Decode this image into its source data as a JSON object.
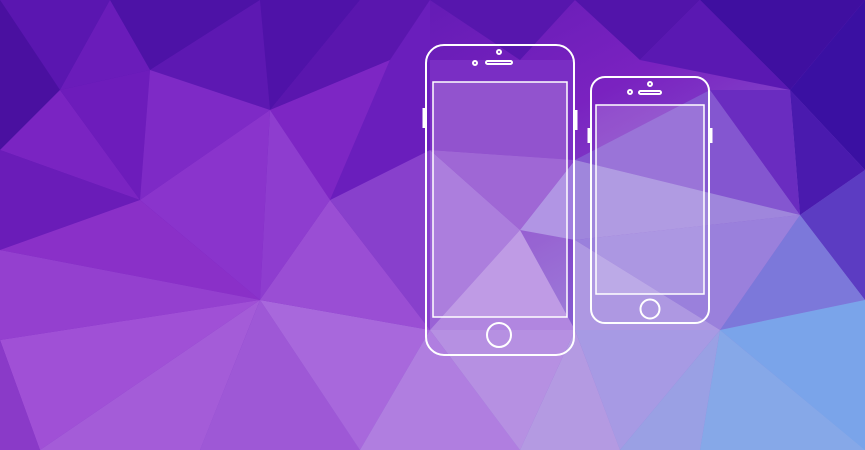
{
  "scene": {
    "background_palette": {
      "deep_indigo": "#3d0fa0",
      "violet": "#6a16b8",
      "purple": "#8a2fc4",
      "orchid": "#a46ad8",
      "lavender": "#b9a2e6",
      "periwinkle": "#8ca4e6",
      "sky_blue": "#6fa4ea"
    },
    "outline_color": "#ffffff",
    "screen_tint": "rgba(255,255,255,0.18)",
    "devices": [
      {
        "name": "large-phone",
        "screen": "blank"
      },
      {
        "name": "small-phone",
        "screen": "blank"
      }
    ]
  }
}
